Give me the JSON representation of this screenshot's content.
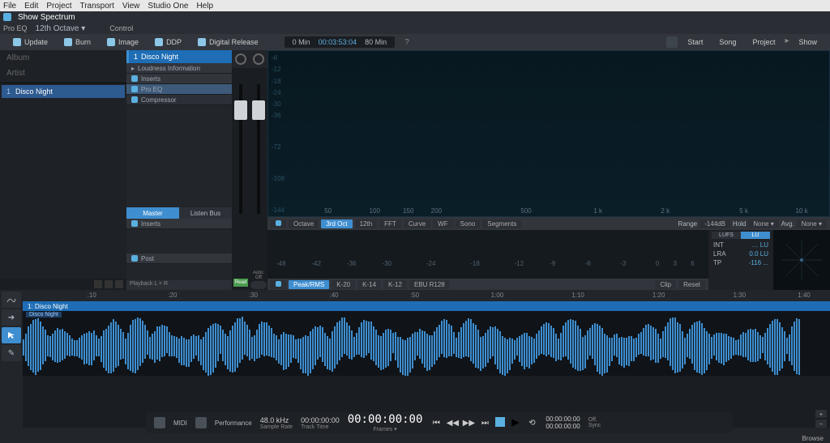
{
  "menu": {
    "items": [
      "File",
      "Edit",
      "Project",
      "Transport",
      "View",
      "Studio One",
      "Help"
    ]
  },
  "titlebar": {
    "title": "Show Spectrum",
    "subtitle": "Pro EQ",
    "select": "12th Octave",
    "control": "Control"
  },
  "toolbar": {
    "buttons": [
      "Update",
      "Burn",
      "Image",
      "DDP",
      "Digital Release"
    ],
    "timebox": {
      "start": "0 Min",
      "mid": "00:03:53:04",
      "end": "80 Min"
    },
    "right": [
      "Start",
      "Song",
      "Project",
      "Show"
    ]
  },
  "left": {
    "album": "Album",
    "artist": "Artist",
    "track_num": "1",
    "track_name": "Disco Night"
  },
  "mid": {
    "track_num": "1",
    "track_name": "Disco Night",
    "rows": [
      {
        "label": "Loudness Information",
        "type": "hdr"
      },
      {
        "label": "Inserts",
        "type": "hdr",
        "pwr": true
      },
      {
        "label": "Pro EQ",
        "type": "fx",
        "pwr": true,
        "sel": true
      },
      {
        "label": "Compressor",
        "type": "fx",
        "pwr": true
      }
    ],
    "tabs": {
      "master": "Master",
      "listen": "Listen Bus"
    },
    "inserts2": "Inserts",
    "post": "Post",
    "playback": "Playback L + R",
    "fader_read": "Read",
    "autooff": "Auto: Off"
  },
  "spectrum": {
    "ylabels": [
      "-6",
      "-12",
      "-18",
      "-24",
      "-30",
      "-36",
      "-72",
      "-108",
      "-144"
    ],
    "xlabels": [
      "50",
      "100",
      "150",
      "200",
      "500",
      "1 k",
      "2 k",
      "5 k",
      "10 k"
    ],
    "ctrl": [
      "Octave",
      "3rd Oct",
      "12th",
      "FFT",
      "Curve",
      "WF",
      "Sono",
      "Segments"
    ],
    "range_label": "Range",
    "range_val": "-144dB",
    "hold": "Hold",
    "none1": "None",
    "avg": "Avg.",
    "none2": "None"
  },
  "meter": {
    "scale": [
      "-48",
      "-42",
      "-36",
      "-30",
      "-24",
      "-18",
      "-12",
      "-9",
      "-6",
      "-3",
      "0",
      "3",
      "6"
    ],
    "ctrl": [
      "Peak/RMS",
      "K-20",
      "K-14",
      "K-12",
      "EBU R128"
    ],
    "clip": "Clip",
    "reset": "Reset"
  },
  "loudness": {
    "tabs": [
      "LUFS",
      "LU"
    ],
    "rows": [
      {
        "k": "INT",
        "v": "… LU"
      },
      {
        "k": "LRA",
        "v": "0.0 LU"
      },
      {
        "k": "TP",
        "v": "-116 ..."
      }
    ]
  },
  "timeline": {
    "marks": [
      ":10",
      ":20",
      ":30",
      ":40",
      ":50",
      "1:00",
      "1:10",
      "1:20",
      "1:30",
      "1:40"
    ],
    "trackhead": "1: Disco Night",
    "clip": "Disco Night"
  },
  "transport": {
    "midi": "MIDI",
    "perf": "Performance",
    "rate": {
      "v": "48.0 kHz",
      "l": "Sample Rate"
    },
    "tt": {
      "v": "00:00:00:00",
      "l": "Track Time"
    },
    "main": "00:00:00:00",
    "main_l": "Frames",
    "offsets": {
      "a": "00:00:00:00",
      "b": "00:00:00:00",
      "off": "Off.",
      "sync": "Sync"
    }
  },
  "bottom": {
    "browse": "Browse"
  }
}
